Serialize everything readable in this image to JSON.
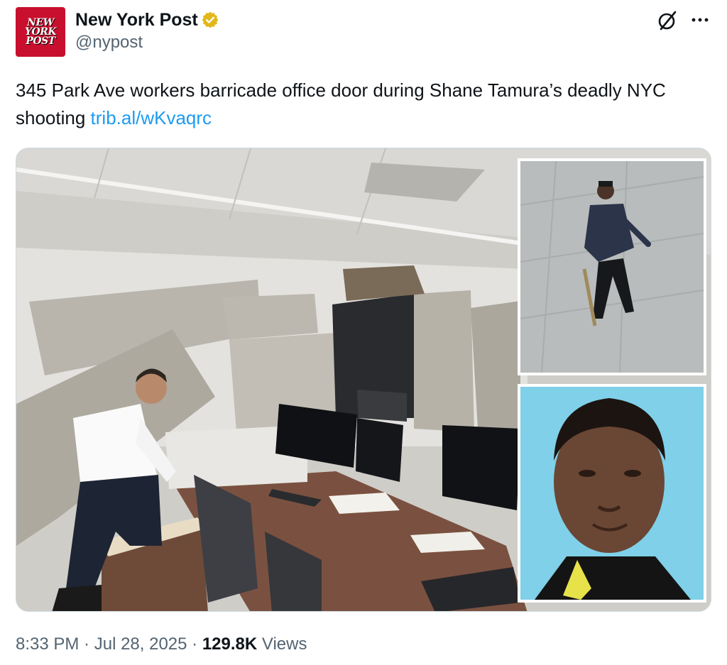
{
  "account": {
    "avatar_lines": [
      "NEW",
      "YORK",
      "POST"
    ],
    "display_name": "New York Post",
    "handle": "@nypost",
    "verified_badge": "gold-verified-badge-icon"
  },
  "actions": {
    "grok_icon": "grok-icon",
    "more_icon": "more-icon"
  },
  "tweet": {
    "text": "345 Park Ave workers barricade office door during Shane Tamura’s deadly NYC shooting ",
    "link": "trib.al/wKvaqrc"
  },
  "meta": {
    "time": "8:33 PM",
    "sep1": " · ",
    "date": "Jul 28, 2025",
    "sep2": " · ",
    "views_count": "129.8K",
    "views_label": " Views"
  },
  "colors": {
    "link": "#1d9bf0",
    "secondary_text": "#536471",
    "verified_gold": "#e2b719",
    "avatar_red": "#c8102e",
    "mugshot_bg": "#7fd0e8"
  }
}
